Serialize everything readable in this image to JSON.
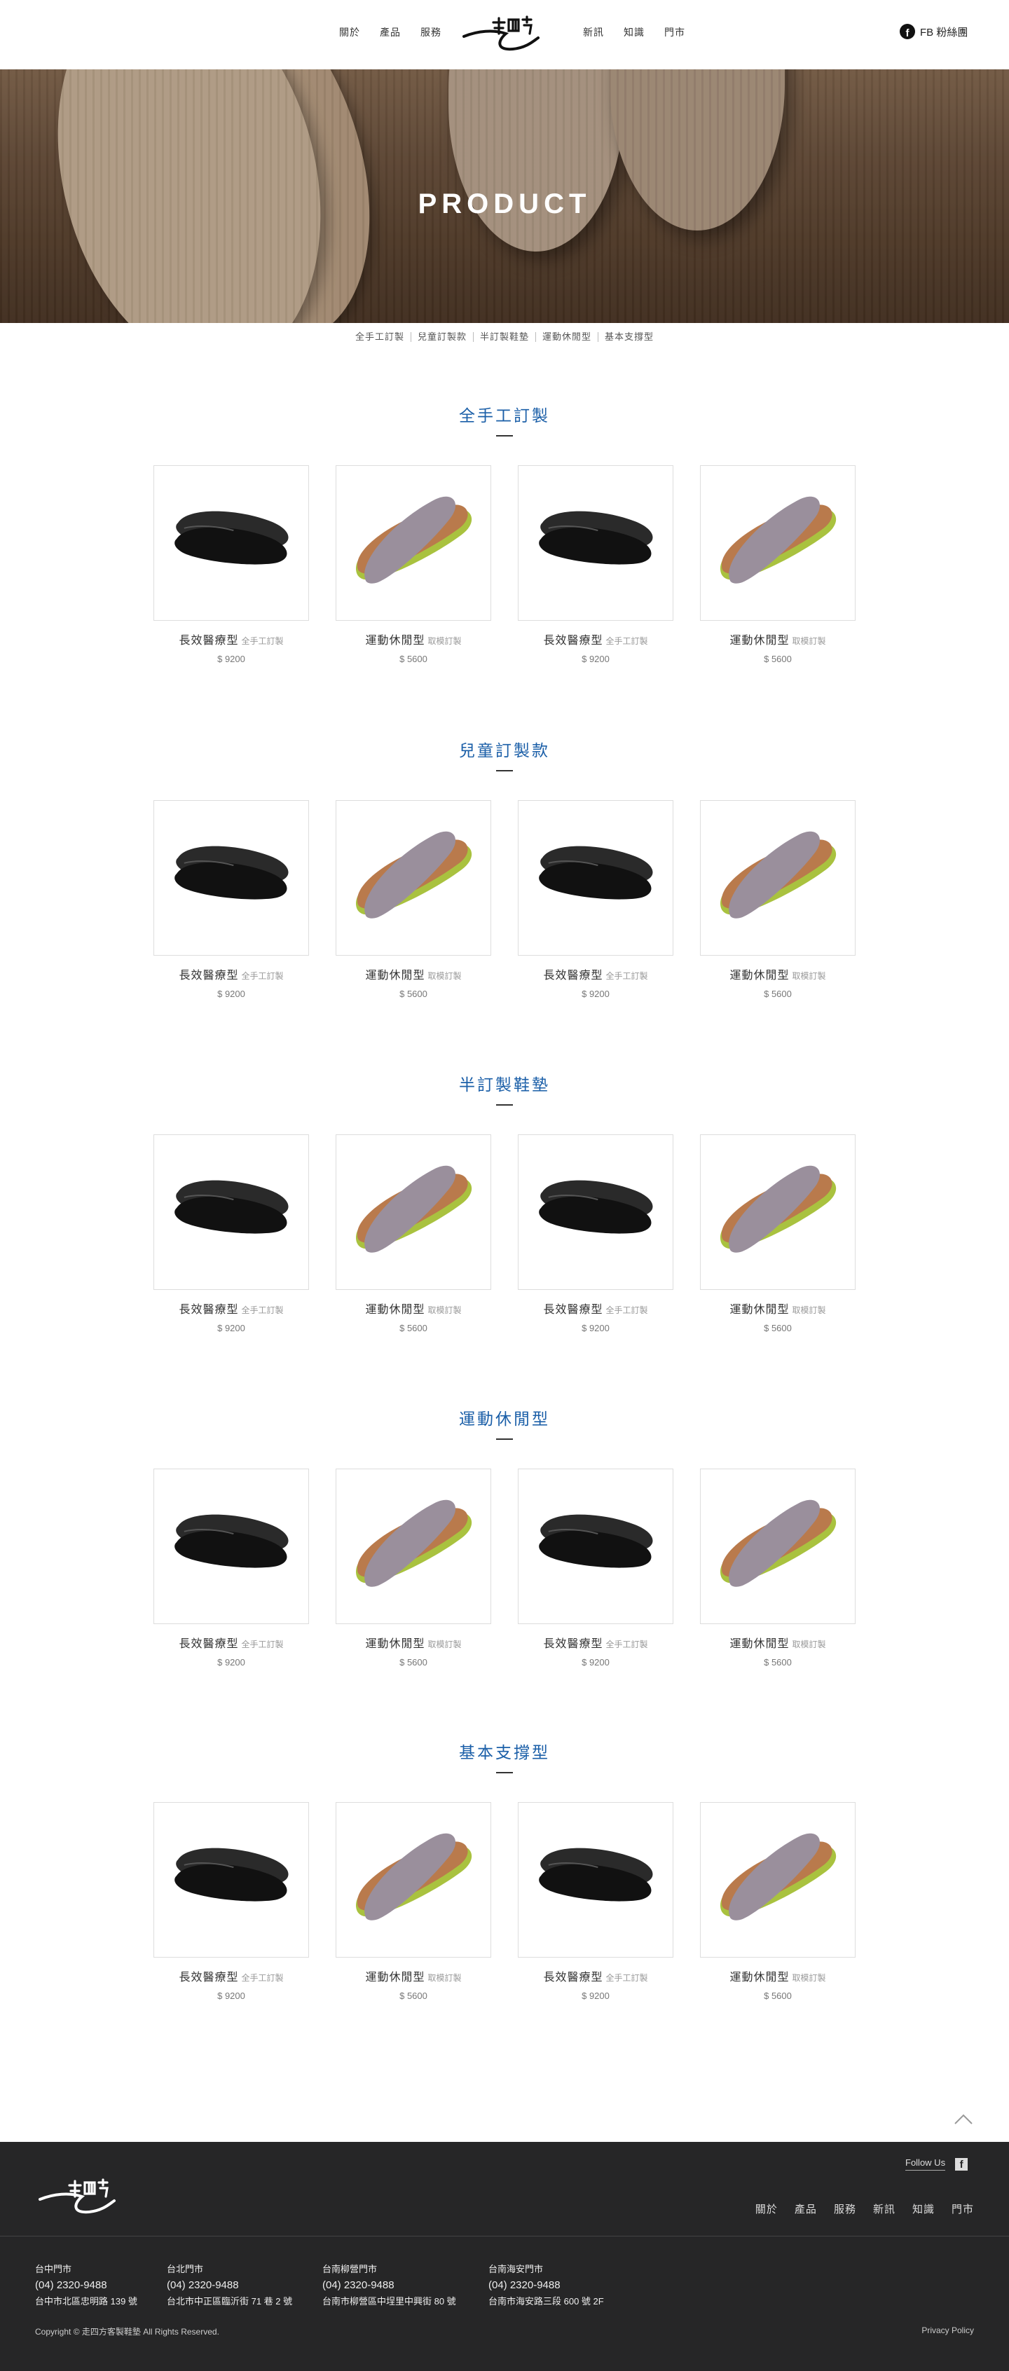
{
  "header": {
    "nav_left": [
      "關於",
      "產品",
      "服務"
    ],
    "nav_right": [
      "新訊",
      "知識",
      "門市"
    ],
    "fb_label": "FB 粉絲團"
  },
  "hero": {
    "title": "PRODUCT"
  },
  "subnav": [
    "全手工訂製",
    "兒童訂製款",
    "半訂製鞋墊",
    "運動休閒型",
    "基本支撐型"
  ],
  "colors": {
    "accent": "#1b5fa8",
    "footer_bg": "#262627",
    "insole_dark": "#111111",
    "insole_grey": "#9a8f9c",
    "insole_green": "#a9c23f"
  },
  "sections": [
    {
      "title": "全手工訂製",
      "products": [
        {
          "name": "長效醫療型",
          "tag": "全手工訂製",
          "price": "$ 9200",
          "image": "black-insole"
        },
        {
          "name": "運動休閒型",
          "tag": "取模訂製",
          "price": "$ 5600",
          "image": "grey-green-insole"
        },
        {
          "name": "長效醫療型",
          "tag": "全手工訂製",
          "price": "$ 9200",
          "image": "black-insole"
        },
        {
          "name": "運動休閒型",
          "tag": "取模訂製",
          "price": "$ 5600",
          "image": "grey-green-insole"
        }
      ]
    },
    {
      "title": "兒童訂製款",
      "products": [
        {
          "name": "長效醫療型",
          "tag": "全手工訂製",
          "price": "$ 9200",
          "image": "black-insole"
        },
        {
          "name": "運動休閒型",
          "tag": "取模訂製",
          "price": "$ 5600",
          "image": "grey-green-insole"
        },
        {
          "name": "長效醫療型",
          "tag": "全手工訂製",
          "price": "$ 9200",
          "image": "black-insole"
        },
        {
          "name": "運動休閒型",
          "tag": "取模訂製",
          "price": "$ 5600",
          "image": "grey-green-insole"
        }
      ]
    },
    {
      "title": "半訂製鞋墊",
      "products": [
        {
          "name": "長效醫療型",
          "tag": "全手工訂製",
          "price": "$ 9200",
          "image": "black-insole"
        },
        {
          "name": "運動休閒型",
          "tag": "取模訂製",
          "price": "$ 5600",
          "image": "grey-green-insole"
        },
        {
          "name": "長效醫療型",
          "tag": "全手工訂製",
          "price": "$ 9200",
          "image": "black-insole"
        },
        {
          "name": "運動休閒型",
          "tag": "取模訂製",
          "price": "$ 5600",
          "image": "grey-green-insole"
        }
      ]
    },
    {
      "title": "運動休閒型",
      "products": [
        {
          "name": "長效醫療型",
          "tag": "全手工訂製",
          "price": "$ 9200",
          "image": "black-insole"
        },
        {
          "name": "運動休閒型",
          "tag": "取模訂製",
          "price": "$ 5600",
          "image": "grey-green-insole"
        },
        {
          "name": "長效醫療型",
          "tag": "全手工訂製",
          "price": "$ 9200",
          "image": "black-insole"
        },
        {
          "name": "運動休閒型",
          "tag": "取模訂製",
          "price": "$ 5600",
          "image": "grey-green-insole"
        }
      ]
    },
    {
      "title": "基本支撐型",
      "products": [
        {
          "name": "長效醫療型",
          "tag": "全手工訂製",
          "price": "$ 9200",
          "image": "black-insole"
        },
        {
          "name": "運動休閒型",
          "tag": "取模訂製",
          "price": "$ 5600",
          "image": "grey-green-insole"
        },
        {
          "name": "長效醫療型",
          "tag": "全手工訂製",
          "price": "$ 9200",
          "image": "black-insole"
        },
        {
          "name": "運動休閒型",
          "tag": "取模訂製",
          "price": "$ 5600",
          "image": "grey-green-insole"
        }
      ]
    }
  ],
  "footer": {
    "follow_label": "Follow Us",
    "nav": [
      "關於",
      "產品",
      "服務",
      "新訊",
      "知識",
      "門市"
    ],
    "stores": [
      {
        "name": "台中門市",
        "phone": "(04) 2320-9488",
        "address": "台中市北區忠明路 139 號"
      },
      {
        "name": "台北門市",
        "phone": "(04) 2320-9488",
        "address": "台北市中正區臨沂街 71 巷 2 號"
      },
      {
        "name": "台南柳營門市",
        "phone": "(04) 2320-9488",
        "address": "台南市柳營區中埕里中興街 80 號"
      },
      {
        "name": "台南海安門市",
        "phone": "(04) 2320-9488",
        "address": "台南市海安路三段 600 號 2F"
      }
    ],
    "copyright": "Copyright © 走四方客製鞋墊 All Rights Reserved.",
    "privacy": "Privacy Policy"
  }
}
